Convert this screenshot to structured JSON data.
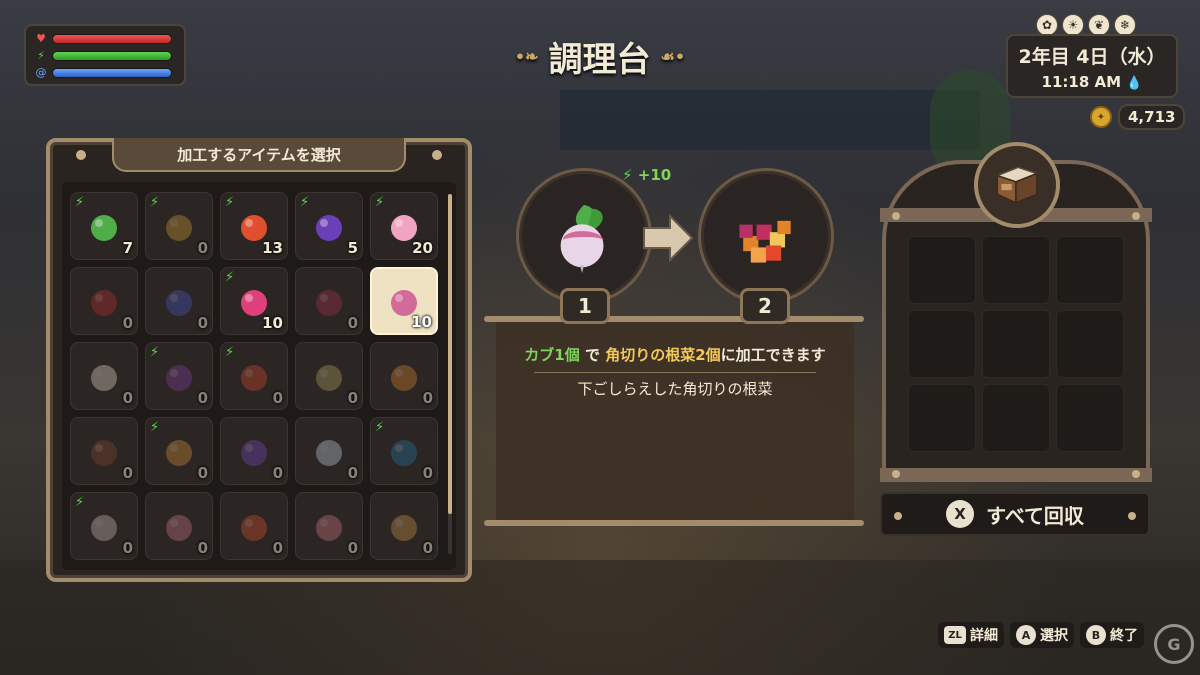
{
  "hud": {
    "status_icons": [
      "heart-icon",
      "lightning-icon",
      "swirl-icon"
    ],
    "seasons": [
      "spring-flower-icon",
      "summer-sun-icon",
      "autumn-leaf-icon",
      "winter-snowflake-icon"
    ],
    "date": "2年目 4日（水）",
    "time": "11:18 AM",
    "money": "4,713"
  },
  "title": "調理台",
  "inventory": {
    "header": "加工するアイテムを選択",
    "items": [
      {
        "name": "green-herb",
        "count": "7",
        "boost": true,
        "color": "#4fae4a",
        "empty": false
      },
      {
        "name": "dandelion",
        "count": "0",
        "boost": true,
        "color": "#d9a12e",
        "empty": true
      },
      {
        "name": "red-lily",
        "count": "13",
        "boost": true,
        "color": "#e0502e",
        "empty": false
      },
      {
        "name": "dark-iris",
        "count": "5",
        "boost": true,
        "color": "#6b3fb8",
        "empty": false
      },
      {
        "name": "pink-flower",
        "count": "20",
        "boost": true,
        "color": "#f3a3c2",
        "empty": false
      },
      {
        "name": "red-berries",
        "count": "0",
        "boost": false,
        "color": "#c23030",
        "empty": true
      },
      {
        "name": "blueberries",
        "count": "0",
        "boost": false,
        "color": "#4d59c8",
        "empty": true
      },
      {
        "name": "raspberry",
        "count": "10",
        "boost": true,
        "color": "#e0407a",
        "empty": false
      },
      {
        "name": "blackberry",
        "count": "0",
        "boost": false,
        "color": "#b0304a",
        "empty": true
      },
      {
        "name": "turnip",
        "count": "10",
        "boost": false,
        "color": "#d26a9a",
        "empty": false,
        "selected": true
      },
      {
        "name": "cauliflower",
        "count": "0",
        "boost": false,
        "color": "#efe3cf",
        "empty": true
      },
      {
        "name": "purple-beans",
        "count": "0",
        "boost": true,
        "color": "#8a3fa8",
        "empty": true
      },
      {
        "name": "tomato",
        "count": "0",
        "boost": true,
        "color": "#e04a2a",
        "empty": true
      },
      {
        "name": "grapes",
        "count": "0",
        "boost": false,
        "color": "#b8a860",
        "empty": true
      },
      {
        "name": "sea-buckthorn",
        "count": "0",
        "boost": false,
        "color": "#e0842a",
        "empty": true
      },
      {
        "name": "chestnut",
        "count": "0",
        "boost": false,
        "color": "#8a4a2a",
        "empty": true
      },
      {
        "name": "chanterelle",
        "count": "0",
        "boost": true,
        "color": "#e0943a",
        "empty": true
      },
      {
        "name": "purple-mushroom",
        "count": "0",
        "boost": false,
        "color": "#7a4ac8",
        "empty": true
      },
      {
        "name": "white-mushroom",
        "count": "0",
        "boost": false,
        "color": "#c8d8e8",
        "empty": true
      },
      {
        "name": "mussel",
        "count": "0",
        "boost": true,
        "color": "#2a7aa8",
        "empty": true
      },
      {
        "name": "clam",
        "count": "0",
        "boost": true,
        "color": "#d8c8c0",
        "empty": true
      },
      {
        "name": "small-fish",
        "count": "0",
        "boost": false,
        "color": "#d87a8a",
        "empty": true
      },
      {
        "name": "red-fish",
        "count": "0",
        "boost": false,
        "color": "#e0502a",
        "empty": true
      },
      {
        "name": "pink-fish",
        "count": "0",
        "boost": false,
        "color": "#e07a8a",
        "empty": true
      },
      {
        "name": "flatfish",
        "count": "0",
        "boost": false,
        "color": "#d89a4a",
        "empty": true
      }
    ]
  },
  "recipe": {
    "gain": "+10",
    "input_qty": "1",
    "output_qty": "2",
    "desc_ingredient": "カブ1個",
    "desc_particle": "で",
    "desc_product": "角切りの根菜2個",
    "desc_suffix": "に加工できます",
    "product_name": "下ごしらえした角切りの根菜"
  },
  "output": {
    "collect_key": "X",
    "collect_label": "すべて回収"
  },
  "help": {
    "zl_key": "ZL",
    "zl_label": "詳細",
    "a_key": "A",
    "a_label": "選択",
    "b_key": "B",
    "b_label": "終了"
  },
  "watermark": "G"
}
